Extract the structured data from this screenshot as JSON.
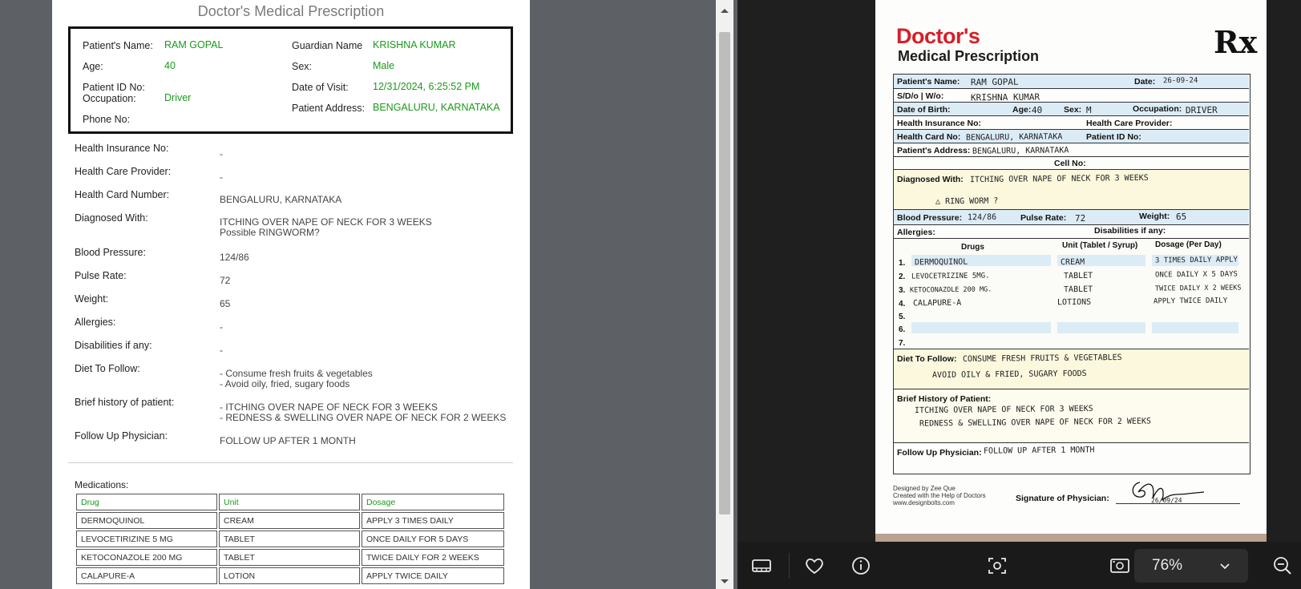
{
  "left": {
    "title": "Doctor's Medical Prescription",
    "patient_box": {
      "name_label": "Patient's Name:",
      "name": "RAM GOPAL",
      "guardian_label": "Guardian Name",
      "guardian": "KRISHNA KUMAR",
      "age_label": "Age:",
      "age": "40",
      "sex_label": "Sex:",
      "sex": "Male",
      "pid_label": "Patient ID No:",
      "visit_label": "Date of Visit:",
      "visit": "12/31/2024, 6:25:52 PM",
      "occupation_label": "Occupation:",
      "occupation": "Driver",
      "address_label": "Patient Address:",
      "address": "BENGALURU, KARNATAKA",
      "phone_label": "Phone No:"
    },
    "info": [
      {
        "label": "Health Insurance No:",
        "value": "-"
      },
      {
        "label": "Health Care Provider:",
        "value": "-"
      },
      {
        "label": "Health Card Number:",
        "value": "BENGALURU, KARNATAKA"
      },
      {
        "label": "Diagnosed With:",
        "value": "ITCHING OVER NAPE OF NECK FOR 3 WEEKS\nPossible RINGWORM?"
      },
      {
        "label": "Blood Pressure:",
        "value": "124/86"
      },
      {
        "label": "Pulse Rate:",
        "value": "72"
      },
      {
        "label": "Weight:",
        "value": "65"
      },
      {
        "label": "Allergies:",
        "value": "-"
      },
      {
        "label": "Disabilities if any:",
        "value": "-"
      },
      {
        "label": "Diet To Follow:",
        "value": "- Consume fresh fruits & vegetables\n- Avoid oily, fried, sugary foods"
      },
      {
        "label": "Brief history of patient:",
        "value": "- ITCHING OVER NAPE OF NECK FOR 3 WEEKS\n- REDNESS & SWELLING OVER NAPE OF NECK FOR 2 WEEKS"
      },
      {
        "label": "Follow Up Physician:",
        "value": "FOLLOW UP AFTER 1 MONTH"
      }
    ],
    "medications_label": "Medications:",
    "med_headers": {
      "drug": "Drug",
      "unit": "Unit",
      "dosage": "Dosage"
    },
    "medications": [
      {
        "drug": "DERMOQUINOL",
        "unit": "CREAM",
        "dosage": "APPLY 3 TIMES DAILY"
      },
      {
        "drug": "LEVOCETIRIZINE 5 MG",
        "unit": "TABLET",
        "dosage": "ONCE DAILY FOR 5 DAYS"
      },
      {
        "drug": "KETOCONAZOLE 200 MG",
        "unit": "TABLET",
        "dosage": "TWICE DAILY FOR 2 WEEKS"
      },
      {
        "drug": "CALAPURE-A",
        "unit": "LOTION",
        "dosage": "APPLY TWICE DAILY"
      }
    ]
  },
  "scan": {
    "logo_line1": "Doctor's",
    "logo_line2": "Medical Prescription",
    "rx": "Rx",
    "labels": {
      "patient_name": "Patient's Name:",
      "date": "Date:",
      "sdw": "S/D/o | W/o:",
      "dob": "Date of Birth:",
      "age": "Age:",
      "sex": "Sex:",
      "occupation": "Occupation:",
      "insurance": "Health Insurance No:",
      "provider": "Health Care Provider:",
      "card": "Health Card No:",
      "pid": "Patient ID No:",
      "address": "Patient's Address:",
      "cell": "Cell No:",
      "diagnosed": "Diagnosed With:",
      "bp": "Blood Pressure:",
      "pulse": "Pulse Rate:",
      "weight": "Weight:",
      "allergies": "Allergies:",
      "disabilities": "Disabilities if any:",
      "drugs": "Drugs",
      "unit": "Unit (Tablet / Syrup)",
      "dosage": "Dosage (Per Day)",
      "diet": "Diet To Follow:",
      "history": "Brief History of Patient:",
      "followup": "Follow Up Physician:",
      "signature": "Signature of Physician:"
    },
    "handwritten": {
      "name": "RAM GOPAL",
      "date": "26-09-24",
      "sdw": "KRISHNA KUMAR",
      "age": "40",
      "sex": "M",
      "occupation": "DRIVER",
      "card": "BENGALURU, KARNATAKA",
      "address": "BENGALURU, KARNATAKA",
      "diag1": "ITCHING OVER NAPE OF NECK FOR 3 WEEKS",
      "diag2": "△ RING WORM ?",
      "bp": "124/86",
      "pulse": "72",
      "weight": "65",
      "diet1": "CONSUME FRESH FRUITS & VEGETABLES",
      "diet2": "AVOID OILY & FRIED, SUGARY FOODS",
      "hist1": "ITCHING OVER NAPE OF NECK FOR 3 WEEKS",
      "hist2": "REDNESS & SWELLING OVER NAPE OF NECK FOR 2 WEEKS",
      "followup": "FOLLOW UP AFTER 1 MONTH",
      "sig_date": "26/09/24"
    },
    "drug_rows": [
      {
        "n": "1.",
        "drug": "DERMOQUINOL",
        "unit": "CREAM",
        "dosage": "3 TIMES DAILY APPLY"
      },
      {
        "n": "2.",
        "drug": "LEVOCETRIZINE 5MG.",
        "unit": "TABLET",
        "dosage": "ONCE DAILY X 5 DAYS"
      },
      {
        "n": "3.",
        "drug": "KETOCONAZOLE 200 MG.",
        "unit": "TABLET",
        "dosage": "TWICE DAILY X 2 WEEKS"
      },
      {
        "n": "4.",
        "drug": "CALAPURE-A",
        "unit": "LOTIONS",
        "dosage": "APPLY TWICE DAILY"
      },
      {
        "n": "5.",
        "drug": "",
        "unit": "",
        "dosage": ""
      },
      {
        "n": "6.",
        "drug": "",
        "unit": "",
        "dosage": ""
      },
      {
        "n": "7.",
        "drug": "",
        "unit": "",
        "dosage": ""
      }
    ],
    "designed_by": "Designed by Zee Que\nCreated with the Help of Doctors\nwww.designbolts.com"
  },
  "toolbar": {
    "zoom": "76%",
    "icons": [
      "filmstrip-icon",
      "heart-icon",
      "info-icon",
      "crop-icon",
      "slideshow-icon",
      "chevron-down-icon",
      "zoom-out-icon"
    ]
  }
}
